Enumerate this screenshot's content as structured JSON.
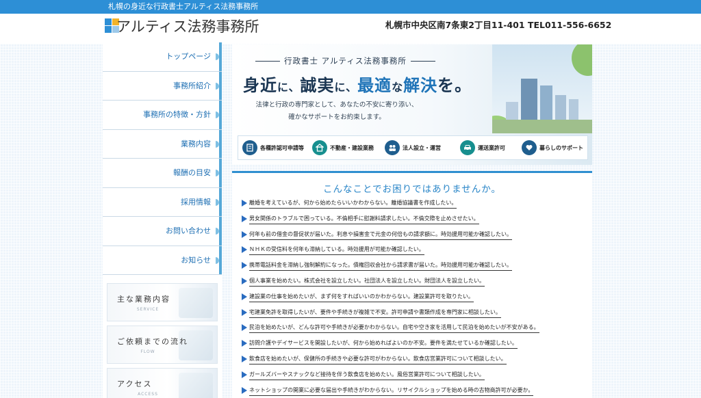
{
  "topbar": {
    "text": "札幌の身近な行政書士アルティス法務事務所"
  },
  "header": {
    "logo_text": "アルティス法務事務所",
    "address": "札幌市中央区南7条東2丁目11-401 TEL011-556-6652",
    "logo_colors": [
      "#2d8fd6",
      "#f2b32a",
      "#555555"
    ]
  },
  "sidebar": {
    "nav": [
      "トップページ",
      "事務所紹介",
      "事務所の特徴・方針",
      "業務内容",
      "報酬の目安",
      "採用情報",
      "お問い合わせ",
      "お知らせ"
    ],
    "banners": [
      {
        "title": "主な業務内容",
        "sub": "SERVICE"
      },
      {
        "title": "ご依頼までの流れ",
        "sub": "FLOW"
      },
      {
        "title": "アクセス",
        "sub": "ACCESS"
      }
    ]
  },
  "hero": {
    "small_title": "行政書士 アルティス法務事務所",
    "headline": [
      "身近",
      "に、",
      "誠実",
      "に、",
      "最適",
      "な",
      "解決",
      "を。"
    ],
    "lead": [
      "法律と行政の専門家として、あなたの不安に寄り添い、",
      "確かなサポートをお約束します。"
    ],
    "services": [
      {
        "label": "各種許認可申請等",
        "icon": "document-icon"
      },
      {
        "label": "不動産・建設業務",
        "icon": "building-icon"
      },
      {
        "label": "法人設立・運営",
        "icon": "people-icon"
      },
      {
        "label": "運送業許可",
        "icon": "car-icon"
      },
      {
        "label": "暮らしのサポート",
        "icon": "heart-hands-icon"
      }
    ]
  },
  "main": {
    "title": "こんなことでお困りではありませんか。",
    "items": [
      "離婚を考えているが、何から始めたらいいかわからない。離婚協議書を作成したい。",
      "男女関係のトラブルで困っている。不倫相手に慰謝料請求したい。不倫交際を止めさせたい。",
      "何年も前の借金の督促状が届いた。利息や損害金で元金の何倍もの請求額に。時効援用可能か確認したい。",
      "ＮＨＫの受信料を何年も滞納している。時効援用が可能か確認したい。",
      "携帯電話料金を滞納し強制解約になった。債権回収会社から請求書が届いた。時効援用可能か確認したい。",
      "個人事業を始めたい。株式会社を設立したい。社団法人を設立したい。財団法人を設立したい。",
      "建設業の仕事を始めたいが、まず何をすればいいのかわからない。建設業許可を取りたい。",
      "宅建業免許を取得したいが、要件や手続きが複雑で不安。許可申請や書類作成を専門家に相談したい。",
      "民泊を始めたいが、どんな許可や手続きが必要かわからない。自宅や空き家を活用して民泊を始めたいが不安がある。",
      "訪問介護やデイサービスを開設したいが、何から始めればよいのか不安。要件を満たせているか確認したい。",
      "飲食店を始めたいが、保健所の手続きや必要な許可がわからない。飲食店営業許可について相談したい。",
      "ガールズバーやスナックなど接待を伴う飲食店を始めたい。風俗営業許可について相談したい。",
      "ネットショップの開業に必要な届出や手続きがわからない。リサイクルショップを始める時の古物商許可が必要か。"
    ]
  }
}
